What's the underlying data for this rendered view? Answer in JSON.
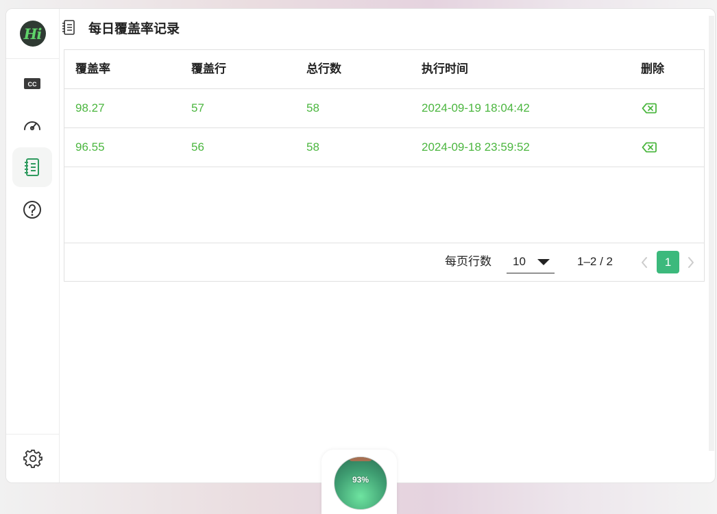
{
  "app": {
    "logo_text": "Hi",
    "accent_color": "#3cb97c",
    "data_color": "#4bb63f"
  },
  "sidebar": {
    "items": [
      {
        "icon": "cc-icon",
        "active": false
      },
      {
        "icon": "speedometer-icon",
        "active": false
      },
      {
        "icon": "notebook-icon",
        "active": true
      },
      {
        "icon": "help-icon",
        "active": false
      }
    ],
    "bottom_icon": "gear-icon"
  },
  "header": {
    "title": "每日覆盖率记录",
    "icon": "notebook-icon"
  },
  "table": {
    "columns": [
      "覆盖率",
      "覆盖行",
      "总行数",
      "执行时间",
      "删除"
    ],
    "rows": [
      {
        "coverage": "98.27",
        "covered": "57",
        "total": "58",
        "time": "2024-09-19 18:04:42",
        "delete_icon": "backspace-icon"
      },
      {
        "coverage": "96.55",
        "covered": "56",
        "total": "58",
        "time": "2024-09-18 23:59:52",
        "delete_icon": "backspace-icon"
      }
    ]
  },
  "pagination": {
    "rows_per_page_label": "每页行数",
    "rows_per_page_value": "10",
    "range": "1–2 / 2",
    "current_page": "1"
  },
  "progress_widget": {
    "percent_text": "93%",
    "fill_fraction": 0.93
  }
}
